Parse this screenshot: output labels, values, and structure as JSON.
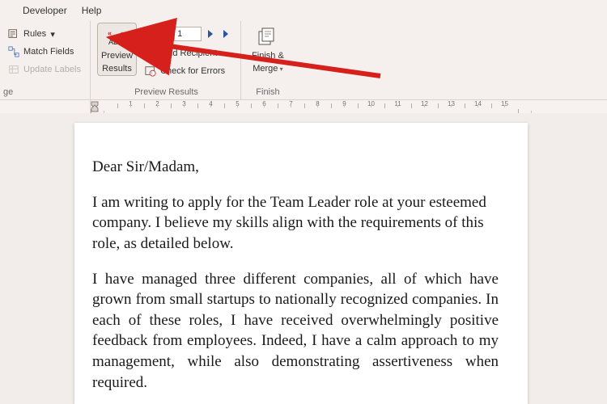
{
  "menubar": {
    "developer": "Developer",
    "help": "Help"
  },
  "ribbon": {
    "rules": "Rules",
    "match_fields": "Match Fields",
    "update_labels": "Update Labels",
    "group1_label": "ge",
    "preview_results_line1": "Preview",
    "preview_results_line2": "Results",
    "record_value": "1",
    "find_recipient": "Find Recipient",
    "check_errors": "Check for Errors",
    "group2_label": "Preview Results",
    "finish_merge_line1": "Finish &",
    "finish_merge_line2": "Merge",
    "group3_label": "Finish"
  },
  "ruler": {
    "ticks": [
      "",
      "1",
      "2",
      "3",
      "4",
      "5",
      "6",
      "7",
      "8",
      "9",
      "10",
      "11",
      "12",
      "13",
      "14",
      "15",
      ""
    ]
  },
  "document": {
    "p1": "Dear Sir/Madam,",
    "p2": "I am writing to apply for the Team Leader role at your esteemed company. I believe my skills align with the requirements of this role, as detailed below.",
    "p3": "I have managed three different companies, all of which have grown from small startups to nationally recognized companies. In each of these roles, I have received overwhelmingly positive feedback from employees. Indeed, I have a calm approach to my management, while also demonstrating assertiveness when required."
  }
}
